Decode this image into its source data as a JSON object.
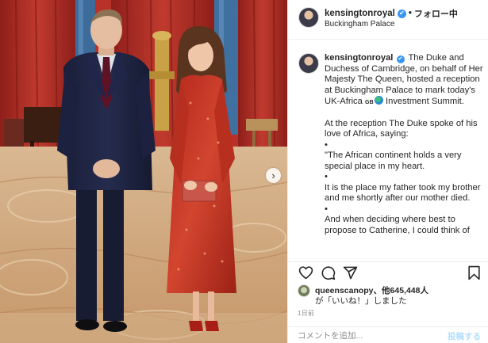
{
  "post": {
    "username": "kensingtonroyal",
    "verified_mark": "✔",
    "separator": "•",
    "follow_label": "フォロー中",
    "location": "Buckingham Palace",
    "next_icon": "›"
  },
  "caption": {
    "username": "kensingtonroyal",
    "verified_mark": "✔",
    "intro": "The Duke and Duchess of Cambridge, on behalf of Her Majesty The Queen, hosted a reception at Buckingham Palace to mark today's UK-Africa",
    "flag_text": "GB",
    "intro_end": "Investment Summit.",
    "para2": "At the reception The Duke spoke of his love of Africa, saying:",
    "bullet": "•",
    "quote1": "\"The African continent holds a very special place in my heart.",
    "quote2": "It is the place my father took my brother and me shortly after our mother died.",
    "quote3": "And when deciding where best to propose to Catherine, I could think of"
  },
  "actions": {
    "like_icon": "heart-icon",
    "comment_icon": "comment-icon",
    "share_icon": "share-icon",
    "save_icon": "bookmark-icon"
  },
  "likes": {
    "user": "queenscanopy",
    "others": "、他645,448人",
    "suffix": "が「いいね！」しました"
  },
  "time_ago": "1日前",
  "comment": {
    "placeholder": "コメントを追加...",
    "post_label": "投稿する"
  },
  "colors": {
    "accent": "#3897f0",
    "post_button_disabled": "#b2dffc",
    "muted_text": "#8e8e8e",
    "border": "#efefef"
  }
}
